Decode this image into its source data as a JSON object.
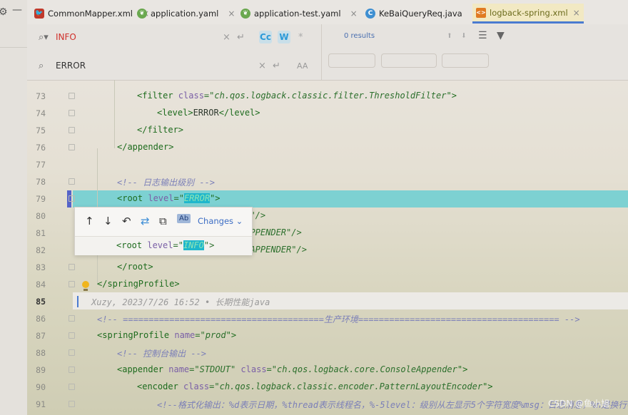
{
  "tabs": [
    {
      "label": "CommonMapper.xml",
      "icon": "mybatis-bird-icon"
    },
    {
      "label": "application.yaml",
      "icon": "spring-leaf-icon"
    },
    {
      "label": "application-test.yaml",
      "icon": "spring-leaf-icon"
    },
    {
      "label": "KeBaiQueryReq.java",
      "icon": "class-icon"
    },
    {
      "label": "logback-spring.xml",
      "icon": "xml-file-icon",
      "active": true
    }
  ],
  "search": {
    "find_value": "INFO",
    "replace_value": "ERROR",
    "results": "0 results",
    "case_badge": "Cc",
    "word_badge": "W",
    "preserve_case": "AA"
  },
  "popup": {
    "changes_label": "Changes",
    "code": {
      "tag_open": "<root ",
      "attr": "level",
      "eq": "=\"",
      "value": "INFO",
      "tail": "\">"
    }
  },
  "lines": [
    {
      "n": "73",
      "indent": 8,
      "kind": "filter-open",
      "tag": "<filter ",
      "attr": "class",
      "value": "ch.qos.logback.classic.filter.ThresholdFilter",
      "end": "\">"
    },
    {
      "n": "74",
      "indent": 10,
      "kind": "level",
      "open": "<level>",
      "text": "ERROR",
      "close": "</level>"
    },
    {
      "n": "75",
      "indent": 8,
      "kind": "close",
      "text": "</filter>"
    },
    {
      "n": "76",
      "indent": 6,
      "kind": "close",
      "text": "</appender>"
    },
    {
      "n": "77",
      "kind": "empty"
    },
    {
      "n": "78",
      "indent": 6,
      "kind": "comment",
      "text": "<!-- 日志输出级别 -->"
    },
    {
      "n": "79",
      "indent": 6,
      "kind": "root",
      "tag": "<root ",
      "attr": "level",
      "value": "ERROR",
      "end": "\">"
    },
    {
      "n": "80",
      "kind": "partial",
      "text": "UT\"/>"
    },
    {
      "n": "81",
      "kind": "partial",
      "text": "_APPENDER\"/>"
    },
    {
      "n": "82",
      "kind": "partial",
      "text": "R_APPENDER\"/>"
    },
    {
      "n": "83",
      "indent": 6,
      "kind": "close",
      "text": "</root>"
    },
    {
      "n": "84",
      "indent": 4,
      "kind": "close",
      "text": "</springProfile>"
    },
    {
      "n": "85",
      "kind": "blame",
      "text": "Xuzy, 2023/7/26 16:52 • 长期性能java"
    },
    {
      "n": "86",
      "indent": 4,
      "kind": "comment",
      "text": "<!-- =======================================生产环境======================================= -->"
    },
    {
      "n": "87",
      "indent": 4,
      "kind": "profile",
      "tag": "<springProfile ",
      "attr": "name",
      "value": "prod",
      "end": "\">"
    },
    {
      "n": "88",
      "indent": 6,
      "kind": "comment",
      "text": "<!-- 控制台输出 -->"
    },
    {
      "n": "89",
      "indent": 6,
      "kind": "appender",
      "tag": "<appender ",
      "attr": "name",
      "value": "STDOUT",
      "attr2": "class",
      "value2": "ch.qos.logback.core.ConsoleAppender",
      "end": "\">"
    },
    {
      "n": "90",
      "indent": 8,
      "kind": "encoder",
      "tag": "<encoder ",
      "attr": "class",
      "value": "ch.qos.logback.classic.encoder.PatternLayoutEncoder",
      "end": "\">"
    },
    {
      "n": "91",
      "indent": 10,
      "kind": "comment",
      "text": "<!--格式化输出：%d表示日期，%thread表示线程名，%-5level：级别从左显示5个字符宽度%msg：日志消息，%n是换行符-->"
    }
  ],
  "watermark": "CSDN @鱼小旭",
  "colors": {
    "highlight_line": "#6ecfd3",
    "match": "#1fb7cc",
    "active_tab_border": "#4a7bd0"
  }
}
